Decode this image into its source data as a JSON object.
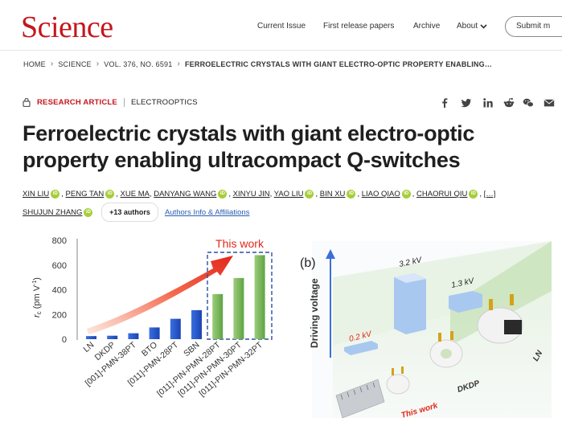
{
  "header": {
    "logo": "Science",
    "nav": [
      "Current Issue",
      "First release papers",
      "Archive",
      "About"
    ],
    "submit_label": "Submit m"
  },
  "breadcrumb": [
    "HOME",
    "SCIENCE",
    "VOL. 376, NO. 6591",
    "FERROELECTRIC CRYSTALS WITH GIANT ELECTRO-OPTIC PROPERTY ENABLING…"
  ],
  "article": {
    "type": "RESEARCH ARTICLE",
    "section": "ELECTROOPTICS",
    "title": "Ferroelectric crystals with giant electro-optic property enabling ultracompact Q-switches",
    "authors": [
      "XIN LIU",
      "PENG TAN",
      "XUE MA",
      "DANYANG WANG",
      "XINYU JIN",
      "YAO LIU",
      "BIN XU",
      "LIAO QIAO",
      "CHAORUI QIU",
      "[…]",
      "SHUJUN ZHANG"
    ],
    "more_authors": "+13 authors",
    "affiliations": "Authors Info & Affiliations",
    "orcid_label": "iD"
  },
  "social_icons": [
    "facebook-icon",
    "twitter-icon",
    "linkedin-icon",
    "reddit-icon",
    "wechat-icon",
    "email-icon"
  ],
  "colors": {
    "brand": "#c4161c",
    "link": "#2a5db0",
    "orcid": "#a6ce39",
    "blue_bar": "#1f4fbf",
    "green_bar": "#7ab85b",
    "arrow": "#e2261b"
  },
  "chart_data": {
    "type": "bar",
    "categories": [
      "LN",
      "DKDP",
      "[001]-PMN-38PT",
      "BTO",
      "[011]-PMN-28PT",
      "SBN",
      "[011]-PIN-PMN-28PT",
      "[011]-PIN-PMN-30PT",
      "[011]-PIN-PMN-32PT"
    ],
    "values": [
      25,
      28,
      48,
      95,
      165,
      235,
      365,
      495,
      680
    ],
    "ylabel": "rc (pm V⁻¹)",
    "ylabel_main": "r",
    "ylabel_sub": "c",
    "ylabel_unit": " (pm V",
    "ylabel_exp": "-1",
    "ylabel_close": ")",
    "ylim": [
      0,
      800
    ],
    "yticks": [
      0,
      200,
      400,
      600,
      800
    ],
    "annotation": "This work",
    "highlight_from_index": 6
  },
  "schematic": {
    "panel_label": "(b)",
    "axis_label": "Driving voltage",
    "voltage_labels": [
      "3.2 kV",
      "1.3 kV",
      "0.2 kV"
    ],
    "crystal_labels": [
      "DKDP",
      "LN"
    ],
    "this_work": "This work"
  }
}
